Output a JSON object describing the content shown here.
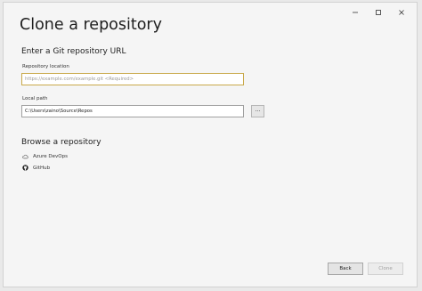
{
  "window": {
    "title": "Clone a repository",
    "controls": [
      "minimize-icon",
      "maximize-icon",
      "close-icon"
    ]
  },
  "git_url_section": {
    "heading": "Enter a Git repository URL",
    "repo_location_label": "Repository location",
    "repo_location_placeholder": "https://example.com/example.git <Required>",
    "repo_location_value": "",
    "local_path_label": "Local path",
    "local_path_value": "C:\\Users\\zaino\\Source\\Repos",
    "browse_label": "..."
  },
  "browse_section": {
    "heading": "Browse a repository",
    "providers": [
      {
        "label": "Azure DevOps",
        "icon": "cloud-icon"
      },
      {
        "label": "GitHub",
        "icon": "github-icon"
      }
    ]
  },
  "footer": {
    "back_label": "Back",
    "clone_label": "Clone"
  },
  "colors": {
    "background": "#f5f5f5",
    "focused_border": "#c9a94a",
    "disabled_text": "#a0a0a0"
  }
}
